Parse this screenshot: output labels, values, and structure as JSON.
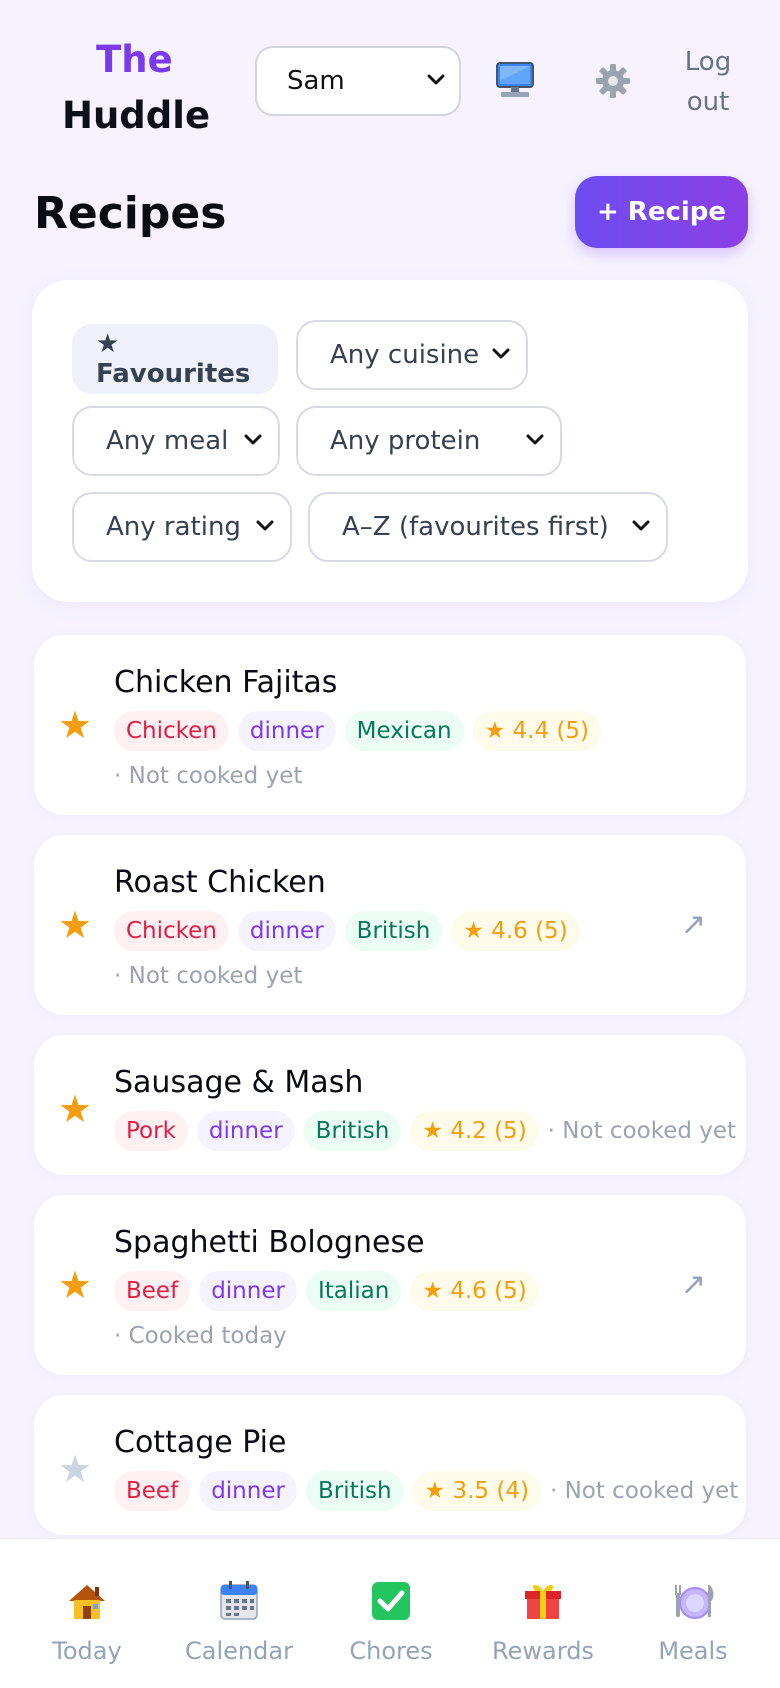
{
  "header": {
    "brand_line1": "The",
    "brand_line2": "Huddle",
    "user_select_value": "Sam",
    "logout_line1": "Log",
    "logout_line2": "out"
  },
  "page": {
    "title": "Recipes",
    "add_button": "+ Recipe"
  },
  "filters": {
    "favourites": "★ Favourites",
    "cuisine": "Any cuisine",
    "meal": "Any meal",
    "protein": "Any protein",
    "rating": "Any rating",
    "sort": "A–Z (favourites first)"
  },
  "recipes": [
    {
      "name": "Chicken Fajitas",
      "favourite": true,
      "protein": "Chicken",
      "meal": "dinner",
      "cuisine": "Mexican",
      "rating": "★ 4.4 (5)",
      "status": "· Not cooked yet",
      "has_link": false
    },
    {
      "name": "Roast Chicken",
      "favourite": true,
      "protein": "Chicken",
      "meal": "dinner",
      "cuisine": "British",
      "rating": "★ 4.6 (5)",
      "status": "· Not cooked yet",
      "has_link": true
    },
    {
      "name": "Sausage & Mash",
      "favourite": true,
      "protein": "Pork",
      "meal": "dinner",
      "cuisine": "British",
      "rating": "★ 4.2 (5)",
      "status": "· Not cooked yet",
      "has_link": false
    },
    {
      "name": "Spaghetti Bolognese",
      "favourite": true,
      "protein": "Beef",
      "meal": "dinner",
      "cuisine": "Italian",
      "rating": "★ 4.6 (5)",
      "status": "· Cooked today",
      "has_link": true
    },
    {
      "name": "Cottage Pie",
      "favourite": false,
      "protein": "Beef",
      "meal": "dinner",
      "cuisine": "British",
      "rating": "★ 3.5 (4)",
      "status": "· Not cooked yet",
      "has_link": false
    }
  ],
  "icons": {
    "star_filled": "★",
    "star_empty": "★",
    "open_link": "↗"
  },
  "nav": [
    {
      "label": "Today",
      "icon": "house-icon"
    },
    {
      "label": "Calendar",
      "icon": "calendar-icon"
    },
    {
      "label": "Chores",
      "icon": "checkmark-icon"
    },
    {
      "label": "Rewards",
      "icon": "gift-icon"
    },
    {
      "label": "Meals",
      "icon": "plate-icon"
    }
  ],
  "colors": {
    "accent": "#7c3aed",
    "star": "#f59e0b",
    "background": "#f6f3ff"
  }
}
